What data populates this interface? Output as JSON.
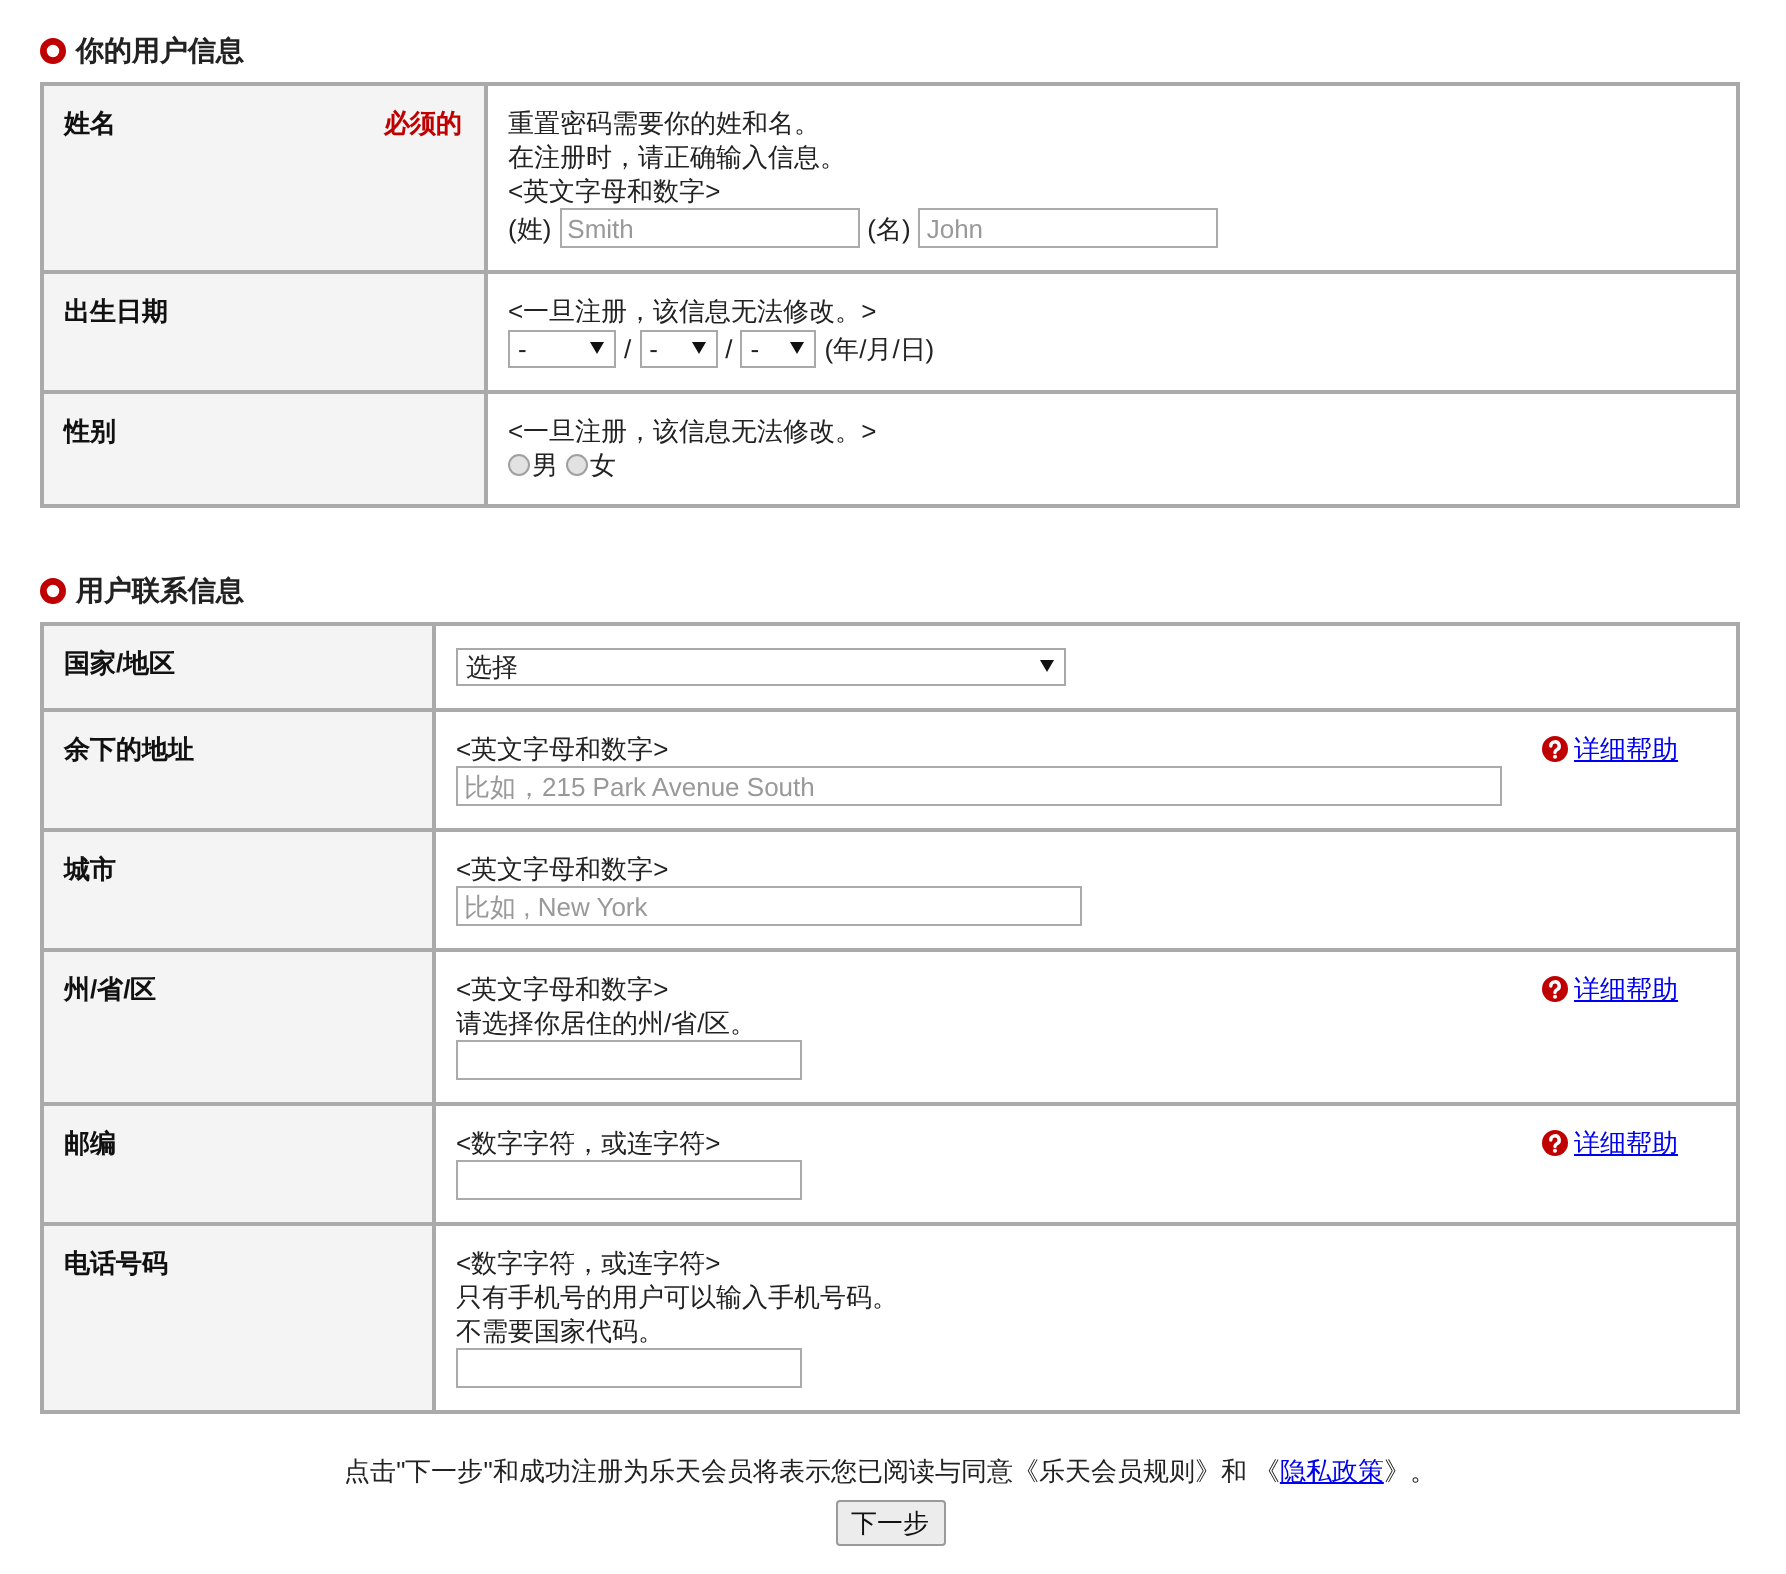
{
  "sections": [
    {
      "title": "你的用户信息",
      "rows": [
        {
          "label": "姓名",
          "required": "必须的",
          "lines": [
            {
              "items": [
                {
                  "kind": "text",
                  "text": "重置密码需要你的姓和名。"
                }
              ]
            },
            {
              "items": [
                {
                  "kind": "text",
                  "text": "在注册时，请正确输入信息。"
                }
              ]
            },
            {
              "items": [
                {
                  "kind": "text",
                  "text": "<英文字母和数字>"
                }
              ]
            },
            {
              "items": [
                {
                  "kind": "text",
                  "text": "(姓)"
                },
                {
                  "kind": "input",
                  "placeholder": "Smith"
                },
                {
                  "kind": "text",
                  "text": "(名)"
                },
                {
                  "kind": "input",
                  "placeholder": "John"
                }
              ]
            }
          ]
        },
        {
          "label": "出生日期",
          "lines": [
            {
              "items": [
                {
                  "kind": "text",
                  "text": "<一旦注册，该信息无法修改。>"
                }
              ]
            },
            {
              "items": [
                {
                  "kind": "select",
                  "value": "-"
                },
                {
                  "kind": "text",
                  "text": "/"
                },
                {
                  "kind": "select",
                  "value": "-"
                },
                {
                  "kind": "text",
                  "text": "/"
                },
                {
                  "kind": "select",
                  "value": "-"
                },
                {
                  "kind": "text",
                  "text": "(年/月/日)"
                }
              ]
            }
          ]
        },
        {
          "label": "性别",
          "lines": [
            {
              "items": [
                {
                  "kind": "text",
                  "text": "<一旦注册，该信息无法修改。>"
                }
              ]
            },
            {
              "items": [
                {
                  "kind": "radio",
                  "label": "男",
                  "selected": false
                },
                {
                  "kind": "radio",
                  "label": "女",
                  "selected": false
                }
              ]
            }
          ]
        }
      ]
    },
    {
      "title": "用户联系信息",
      "rows": [
        {
          "label": "国家/地区",
          "lines": [
            {
              "items": [
                {
                  "kind": "select",
                  "value": "选择"
                }
              ]
            }
          ]
        },
        {
          "label": "余下的地址",
          "help": "详细帮助",
          "lines": [
            {
              "items": [
                {
                  "kind": "text",
                  "text": "<英文字母和数字>"
                }
              ]
            },
            {
              "items": [
                {
                  "kind": "input",
                  "placeholder": "比如，215 Park Avenue South"
                }
              ]
            }
          ]
        },
        {
          "label": "城市",
          "lines": [
            {
              "items": [
                {
                  "kind": "text",
                  "text": "<英文字母和数字>"
                }
              ]
            },
            {
              "items": [
                {
                  "kind": "input",
                  "placeholder": "比如 , New York"
                }
              ]
            }
          ]
        },
        {
          "label": "州/省/区",
          "help": "详细帮助",
          "lines": [
            {
              "items": [
                {
                  "kind": "text",
                  "text": "<英文字母和数字>"
                }
              ]
            },
            {
              "items": [
                {
                  "kind": "text",
                  "text": "请选择你居住的州/省/区。"
                }
              ]
            },
            {
              "items": [
                {
                  "kind": "input"
                }
              ]
            }
          ]
        },
        {
          "label": "邮编",
          "help": "详细帮助",
          "lines": [
            {
              "items": [
                {
                  "kind": "text",
                  "text": "<数字字符，或连字符>"
                }
              ]
            },
            {
              "items": [
                {
                  "kind": "input"
                }
              ]
            }
          ]
        },
        {
          "label": "电话号码",
          "lines": [
            {
              "items": [
                {
                  "kind": "text",
                  "text": "<数字字符，或连字符>"
                }
              ]
            },
            {
              "items": [
                {
                  "kind": "text",
                  "text": "只有手机号的用户可以输入手机号码。"
                }
              ]
            },
            {
              "items": [
                {
                  "kind": "text",
                  "text": "不需要国家代码。"
                }
              ]
            },
            {
              "items": [
                {
                  "kind": "input"
                }
              ]
            }
          ]
        }
      ]
    }
  ],
  "agreement": {
    "before": "点击\"下一步\"和成功注册为乐天会员将表示您已阅读与同意《乐天会员规则》和 《",
    "link": "隐私政策",
    "after": "》。"
  },
  "submit": "下一步"
}
